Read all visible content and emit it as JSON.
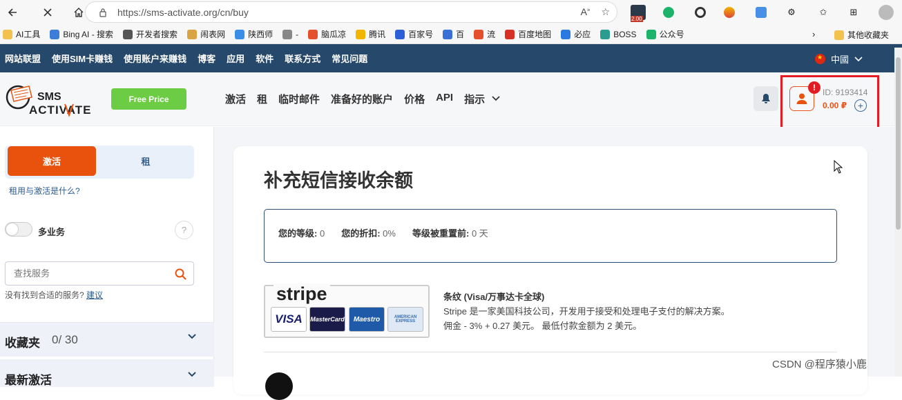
{
  "browser": {
    "url": "https://sms-activate.org/cn/buy",
    "ext_badge": "2.00",
    "bookmarks": [
      "AI工具",
      "Bing AI - 搜索",
      "开发者搜索",
      "闹表网",
      "陕西师",
      "-",
      "脑瓜凉",
      "腾讯",
      "百家号",
      "百",
      "流",
      "百度地图",
      "必应",
      "BOSS",
      "公众号"
    ],
    "bookmarks_other": "其他收藏夹"
  },
  "topbar": {
    "links": [
      "网站联盟",
      "使用SIM卡赚钱",
      "使用账户来赚钱",
      "博客",
      "应用",
      "软件",
      "联系方式",
      "常见问题"
    ],
    "language": "中國"
  },
  "header": {
    "free_price": "Free Price",
    "nav": [
      "激活",
      "租",
      "临时邮件",
      "准备好的账户",
      "价格",
      "API",
      "指示"
    ],
    "user_id": "ID: 9193414",
    "balance": "0.00 ₽",
    "alert": "!"
  },
  "sidebar": {
    "tab_activate": "激活",
    "tab_rent": "租",
    "what_link": "租用与激活是什么?",
    "multi_label": "多业务",
    "help": "?",
    "search_placeholder": "查找服务",
    "notfound_text": "没有找到合适的服务?",
    "notfound_link": "建议",
    "favorites_title": "收藏夹",
    "favorites_count": "0/ 30",
    "recent_title": "最新激活"
  },
  "main": {
    "title": "补充短信接收余额",
    "level_label": "您的等级:",
    "level_value": "0",
    "discount_label": "您的折扣:",
    "discount_value": "0%",
    "reset_label": "等级被重置前:",
    "reset_value": "0 天",
    "stripe_logo": "stripe",
    "cards": [
      "VISA",
      "MasterCard",
      "Maestro",
      "AMERICAN EXPRESS"
    ],
    "stripe_title": "条纹 (Visa/万事达卡全球)",
    "stripe_desc": "Stripe 是一家美国科技公司，开发用于接受和处理电子支付的解决方案。",
    "stripe_fee": "佣金 - 3% + 0.27 美元。 最低付款金额为 2 美元。"
  },
  "watermark": "CSDN @程序猿小鹿",
  "colors": {
    "accent": "#e8520c",
    "topbar": "#25486b",
    "free_price": "#6ccd44",
    "highlight": "#e31c24"
  }
}
